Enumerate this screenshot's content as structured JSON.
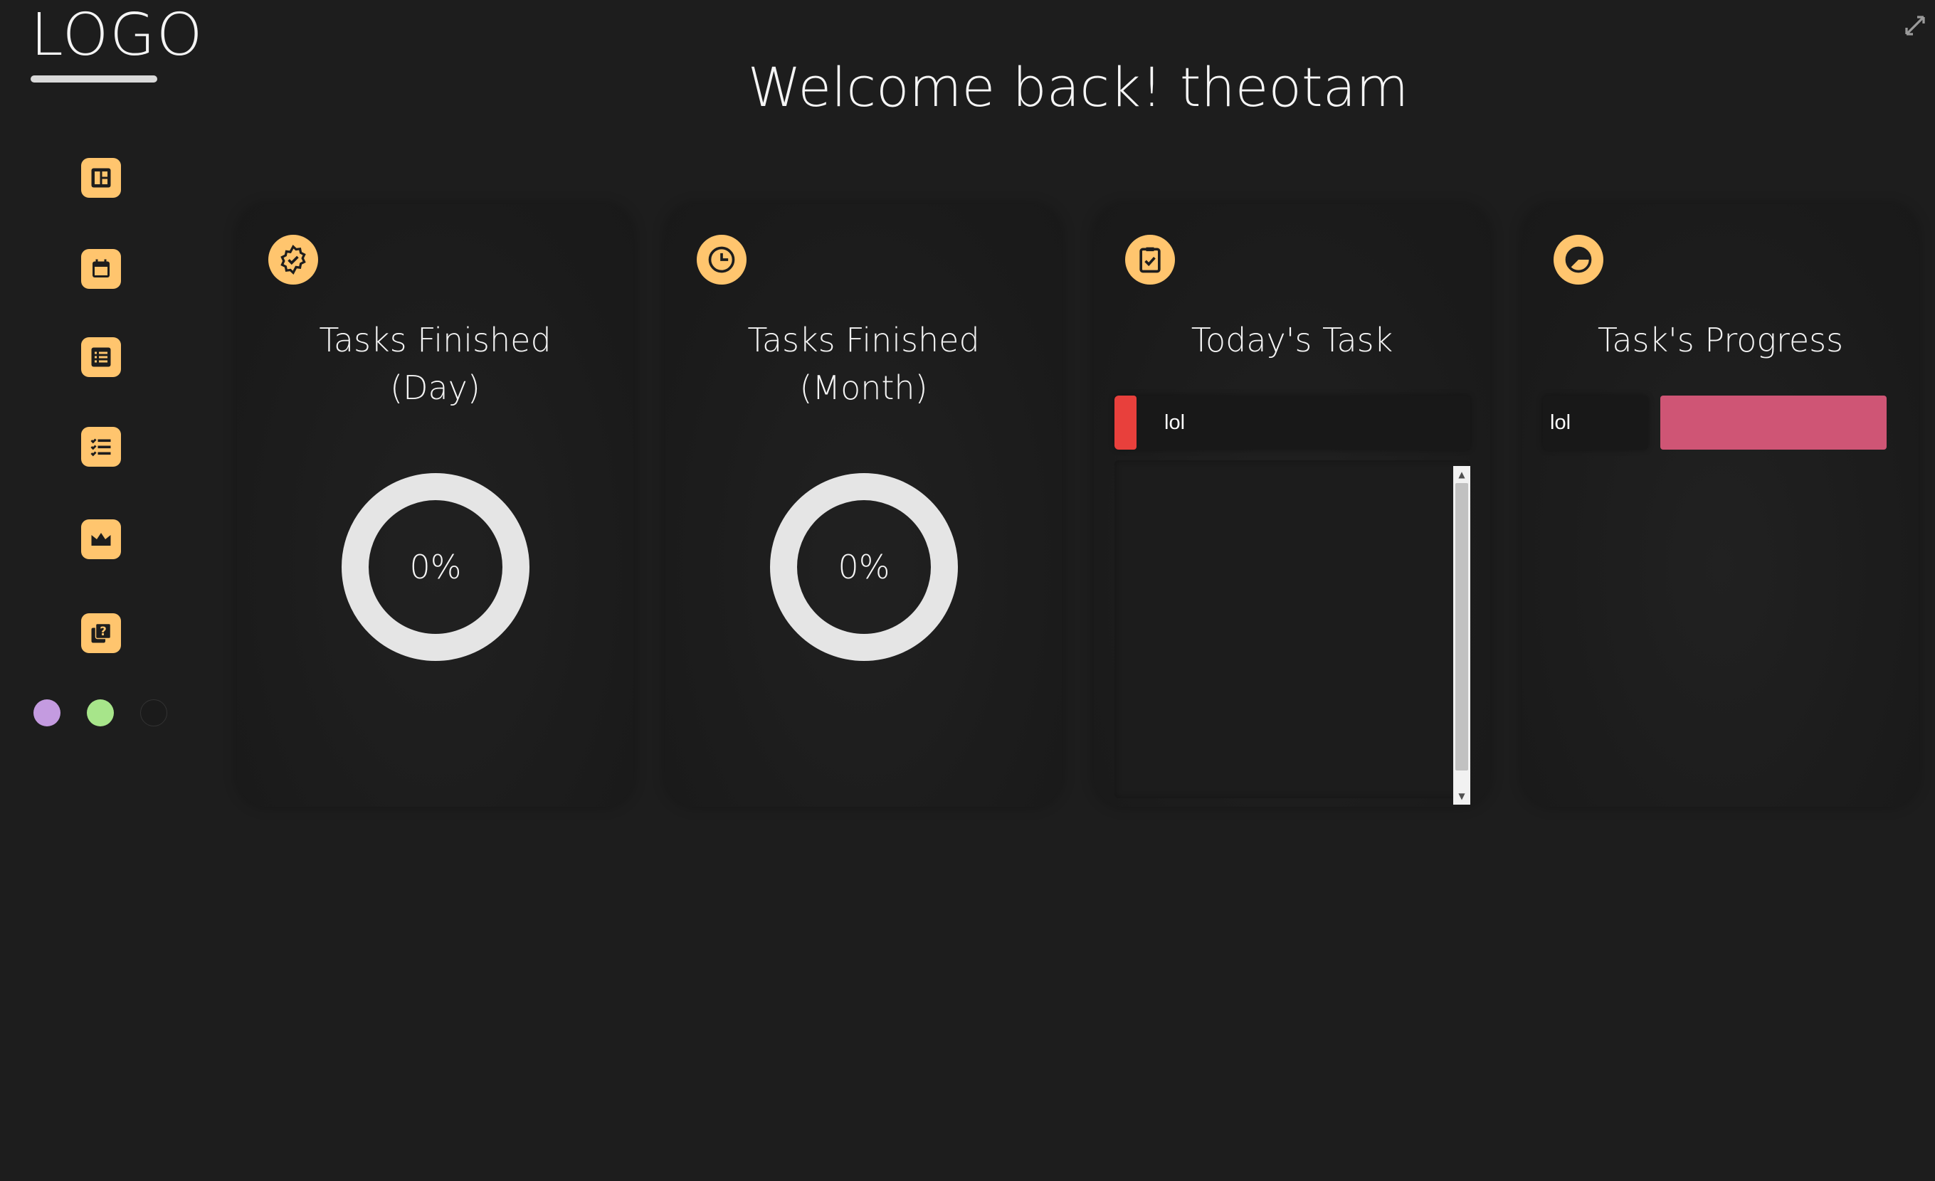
{
  "sidebar": {
    "logo": "LOGO",
    "nav": [
      {
        "icon": "dashboard-icon"
      },
      {
        "icon": "calendar-icon"
      },
      {
        "icon": "list-icon"
      },
      {
        "icon": "checklist-icon"
      },
      {
        "icon": "crown-icon"
      },
      {
        "icon": "help-icon"
      }
    ],
    "themes": [
      {
        "name": "purple",
        "color": "#c49be0"
      },
      {
        "name": "green",
        "color": "#a7e58a"
      },
      {
        "name": "dark",
        "color": "#1b1b1b"
      }
    ]
  },
  "header": {
    "welcome": "Welcome back! theotam"
  },
  "cards": {
    "day": {
      "icon": "badge-check-icon",
      "title_line1": "Tasks Finished",
      "title_line2": "(Day)",
      "percent_label": "0%",
      "percent": 0
    },
    "month": {
      "icon": "clock-icon",
      "title_line1": "Tasks Finished",
      "title_line2": "(Month)",
      "percent_label": "0%",
      "percent": 0
    },
    "today": {
      "icon": "clipboard-check-icon",
      "title": "Today's Task",
      "task": {
        "text": "lol",
        "color": "#e8403c"
      }
    },
    "progress": {
      "icon": "pie-chart-icon",
      "title": "Task's Progress",
      "item": {
        "label": "lol",
        "color": "#cf5575"
      }
    }
  },
  "colors": {
    "background": "#1d1d1d",
    "accent": "#ffc56e",
    "ring": "#e5e5e5"
  }
}
